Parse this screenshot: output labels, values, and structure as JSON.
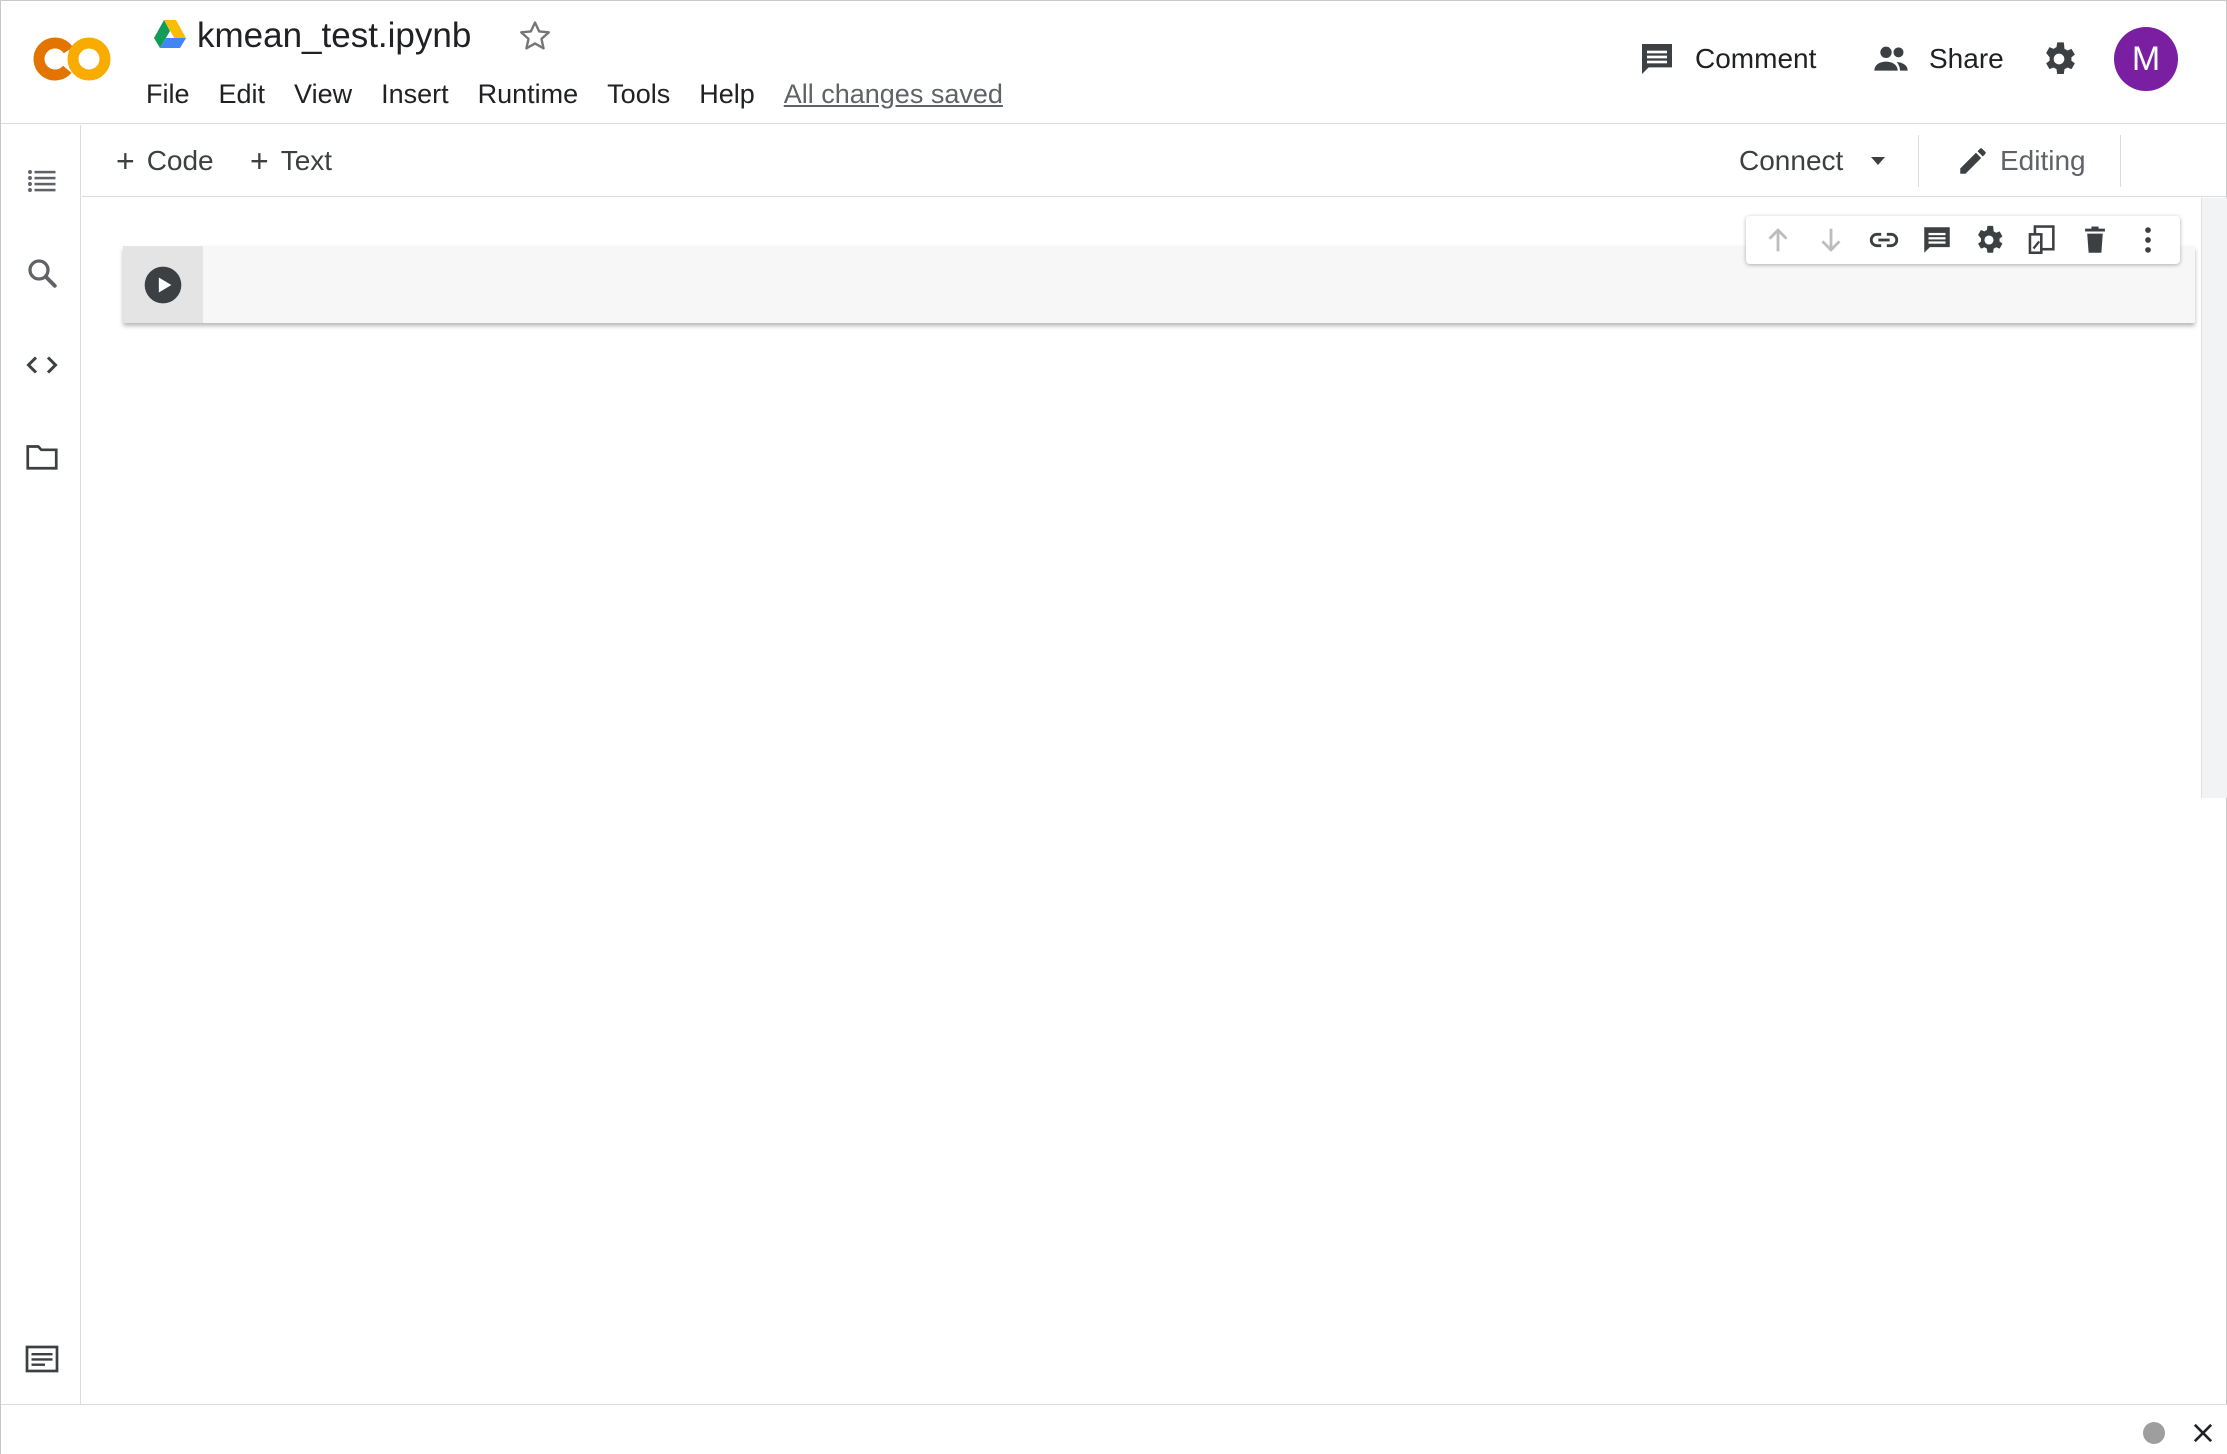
{
  "app": {
    "name": "Colaboratory",
    "logo_text": "CO"
  },
  "notebook": {
    "title": "kmean_test.ipynb",
    "save_status": "All changes saved"
  },
  "menu": [
    "File",
    "Edit",
    "View",
    "Insert",
    "Runtime",
    "Tools",
    "Help"
  ],
  "header": {
    "comment_label": "Comment",
    "share_label": "Share",
    "avatar_initial": "M",
    "avatar_color": "#7b1fa2"
  },
  "toolbar": {
    "add_code_label": "Code",
    "add_text_label": "Text",
    "plus_glyph": "+",
    "connect_label": "Connect",
    "mode_label": "Editing"
  },
  "sidebar": {
    "items": [
      "table-of-contents-icon",
      "search-icon",
      "code-snippets-icon",
      "files-folder-icon"
    ],
    "bottom": "terminal-icon"
  },
  "cell_toolbar": [
    "move-up-icon",
    "move-down-icon",
    "link-icon",
    "comment-icon",
    "settings-icon",
    "mirror-cell-icon",
    "delete-icon",
    "more-vert-icon"
  ],
  "colors": {
    "logo_orange": "#f9ab00",
    "logo_deep_orange": "#e37400",
    "accent": "#7b1fa2"
  }
}
